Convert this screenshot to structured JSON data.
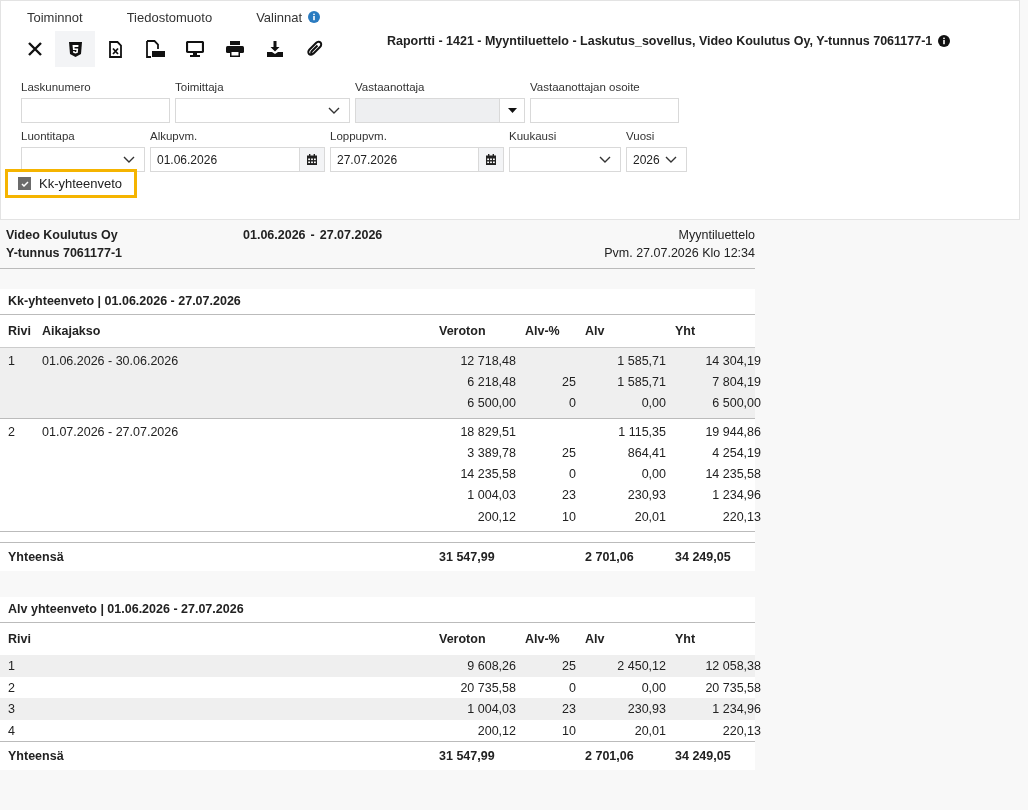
{
  "menu": [
    {
      "label": "Toiminnot",
      "info": false
    },
    {
      "label": "Tiedostomuoto",
      "info": false
    },
    {
      "label": "Valinnat",
      "info": true
    }
  ],
  "toolbar": [
    {
      "kind": "close",
      "selected": false
    },
    {
      "kind": "html",
      "selected": true
    },
    {
      "kind": "excel",
      "selected": false
    },
    {
      "kind": "pdf",
      "selected": false
    },
    {
      "kind": "screen",
      "selected": false
    },
    {
      "kind": "print",
      "selected": false
    },
    {
      "kind": "download",
      "selected": false
    },
    {
      "kind": "attach",
      "selected": false
    }
  ],
  "report_title": "Raportti - 1421 - Myyntiluettelo - Laskutus_sovellus, Video Koulutus Oy, Y-tunnus 7061177-1",
  "filter_rows": [
    [
      {
        "label": "Laskunumero",
        "kind": "text",
        "disabled": false
      },
      {
        "label": "Toimittaja",
        "kind": "select",
        "disabled": false
      },
      {
        "label": "Vastaanottaja",
        "kind": "dropdown",
        "disabled": true
      },
      {
        "label": "Vastaanottajan osoite",
        "kind": "text",
        "disabled": false
      }
    ],
    [
      {
        "label": "Luontitapa",
        "kind": "select",
        "disabled": false
      },
      {
        "label": "Alkupvm.",
        "kind": "date",
        "value": "01.06.2026",
        "disabled": false
      },
      {
        "label": "Loppupvm.",
        "kind": "date",
        "value": "27.07.2026",
        "disabled": false
      },
      {
        "label": "Kuukausi",
        "kind": "select",
        "disabled": false
      },
      {
        "label": "Vuosi",
        "kind": "select",
        "value": "2026",
        "disabled": false
      }
    ]
  ],
  "checkbox": {
    "label": "Kk-yhteenveto",
    "checked": true,
    "highlighted": true
  },
  "report_header": {
    "company": "Video Koulutus Oy",
    "business_id": "Y-tunnus 7061177-1",
    "period_start": "01.06.2026",
    "period_separator": "-",
    "period_end": "27.07.2026",
    "report_name": "Myyntiluettelo",
    "printed": "Pvm. 27.07.2026 Klo 12:34"
  },
  "monthly_summary": {
    "title": "Kk-yhteenveto | 01.06.2026 - 27.07.2026",
    "columns": [
      "Rivi",
      "Aikajakso",
      "Veroton",
      "Alv-%",
      "Alv",
      "Yht"
    ],
    "groups": [
      {
        "shaded": true,
        "rows": [
          [
            "1",
            "01.06.2026 - 30.06.2026",
            "12 718,48",
            null,
            "1 585,71",
            "14 304,19"
          ],
          [
            null,
            null,
            "6 218,48",
            "25",
            "1 585,71",
            "7 804,19"
          ],
          [
            null,
            null,
            "6 500,00",
            "0",
            "0,00",
            "6 500,00"
          ]
        ]
      },
      {
        "shaded": false,
        "rows": [
          [
            "2",
            "01.07.2026 - 27.07.2026",
            "18 829,51",
            null,
            "1 115,35",
            "19 944,86"
          ],
          [
            null,
            null,
            "3 389,78",
            "25",
            "864,41",
            "4 254,19"
          ],
          [
            null,
            null,
            "14 235,58",
            "0",
            "0,00",
            "14 235,58"
          ],
          [
            null,
            null,
            "1 004,03",
            "23",
            "230,93",
            "1 234,96"
          ],
          [
            null,
            null,
            "200,12",
            "10",
            "20,01",
            "220,13"
          ]
        ]
      }
    ],
    "total": {
      "label": "Yhteensä",
      "veroton": "31 547,99",
      "alv": "2 701,06",
      "yht": "34 249,05"
    }
  },
  "vat_summary": {
    "title": "Alv yhteenveto | 01.06.2026 - 27.07.2026",
    "columns": [
      "Rivi",
      null,
      "Veroton",
      "Alv-%",
      "Alv",
      "Yht"
    ],
    "rows": [
      {
        "shaded": true,
        "cells": [
          "1",
          null,
          "9 608,26",
          "25",
          "2 450,12",
          "12 058,38"
        ]
      },
      {
        "shaded": false,
        "cells": [
          "2",
          null,
          "20 735,58",
          "0",
          "0,00",
          "20 735,58"
        ]
      },
      {
        "shaded": true,
        "cells": [
          "3",
          null,
          "1 004,03",
          "23",
          "230,93",
          "1 234,96"
        ]
      },
      {
        "shaded": false,
        "cells": [
          "4",
          null,
          "200,12",
          "10",
          "20,01",
          "220,13"
        ]
      }
    ],
    "total": {
      "label": "Yhteensä",
      "veroton": "31 547,99",
      "alv": "2 701,06",
      "yht": "34 249,05"
    }
  }
}
